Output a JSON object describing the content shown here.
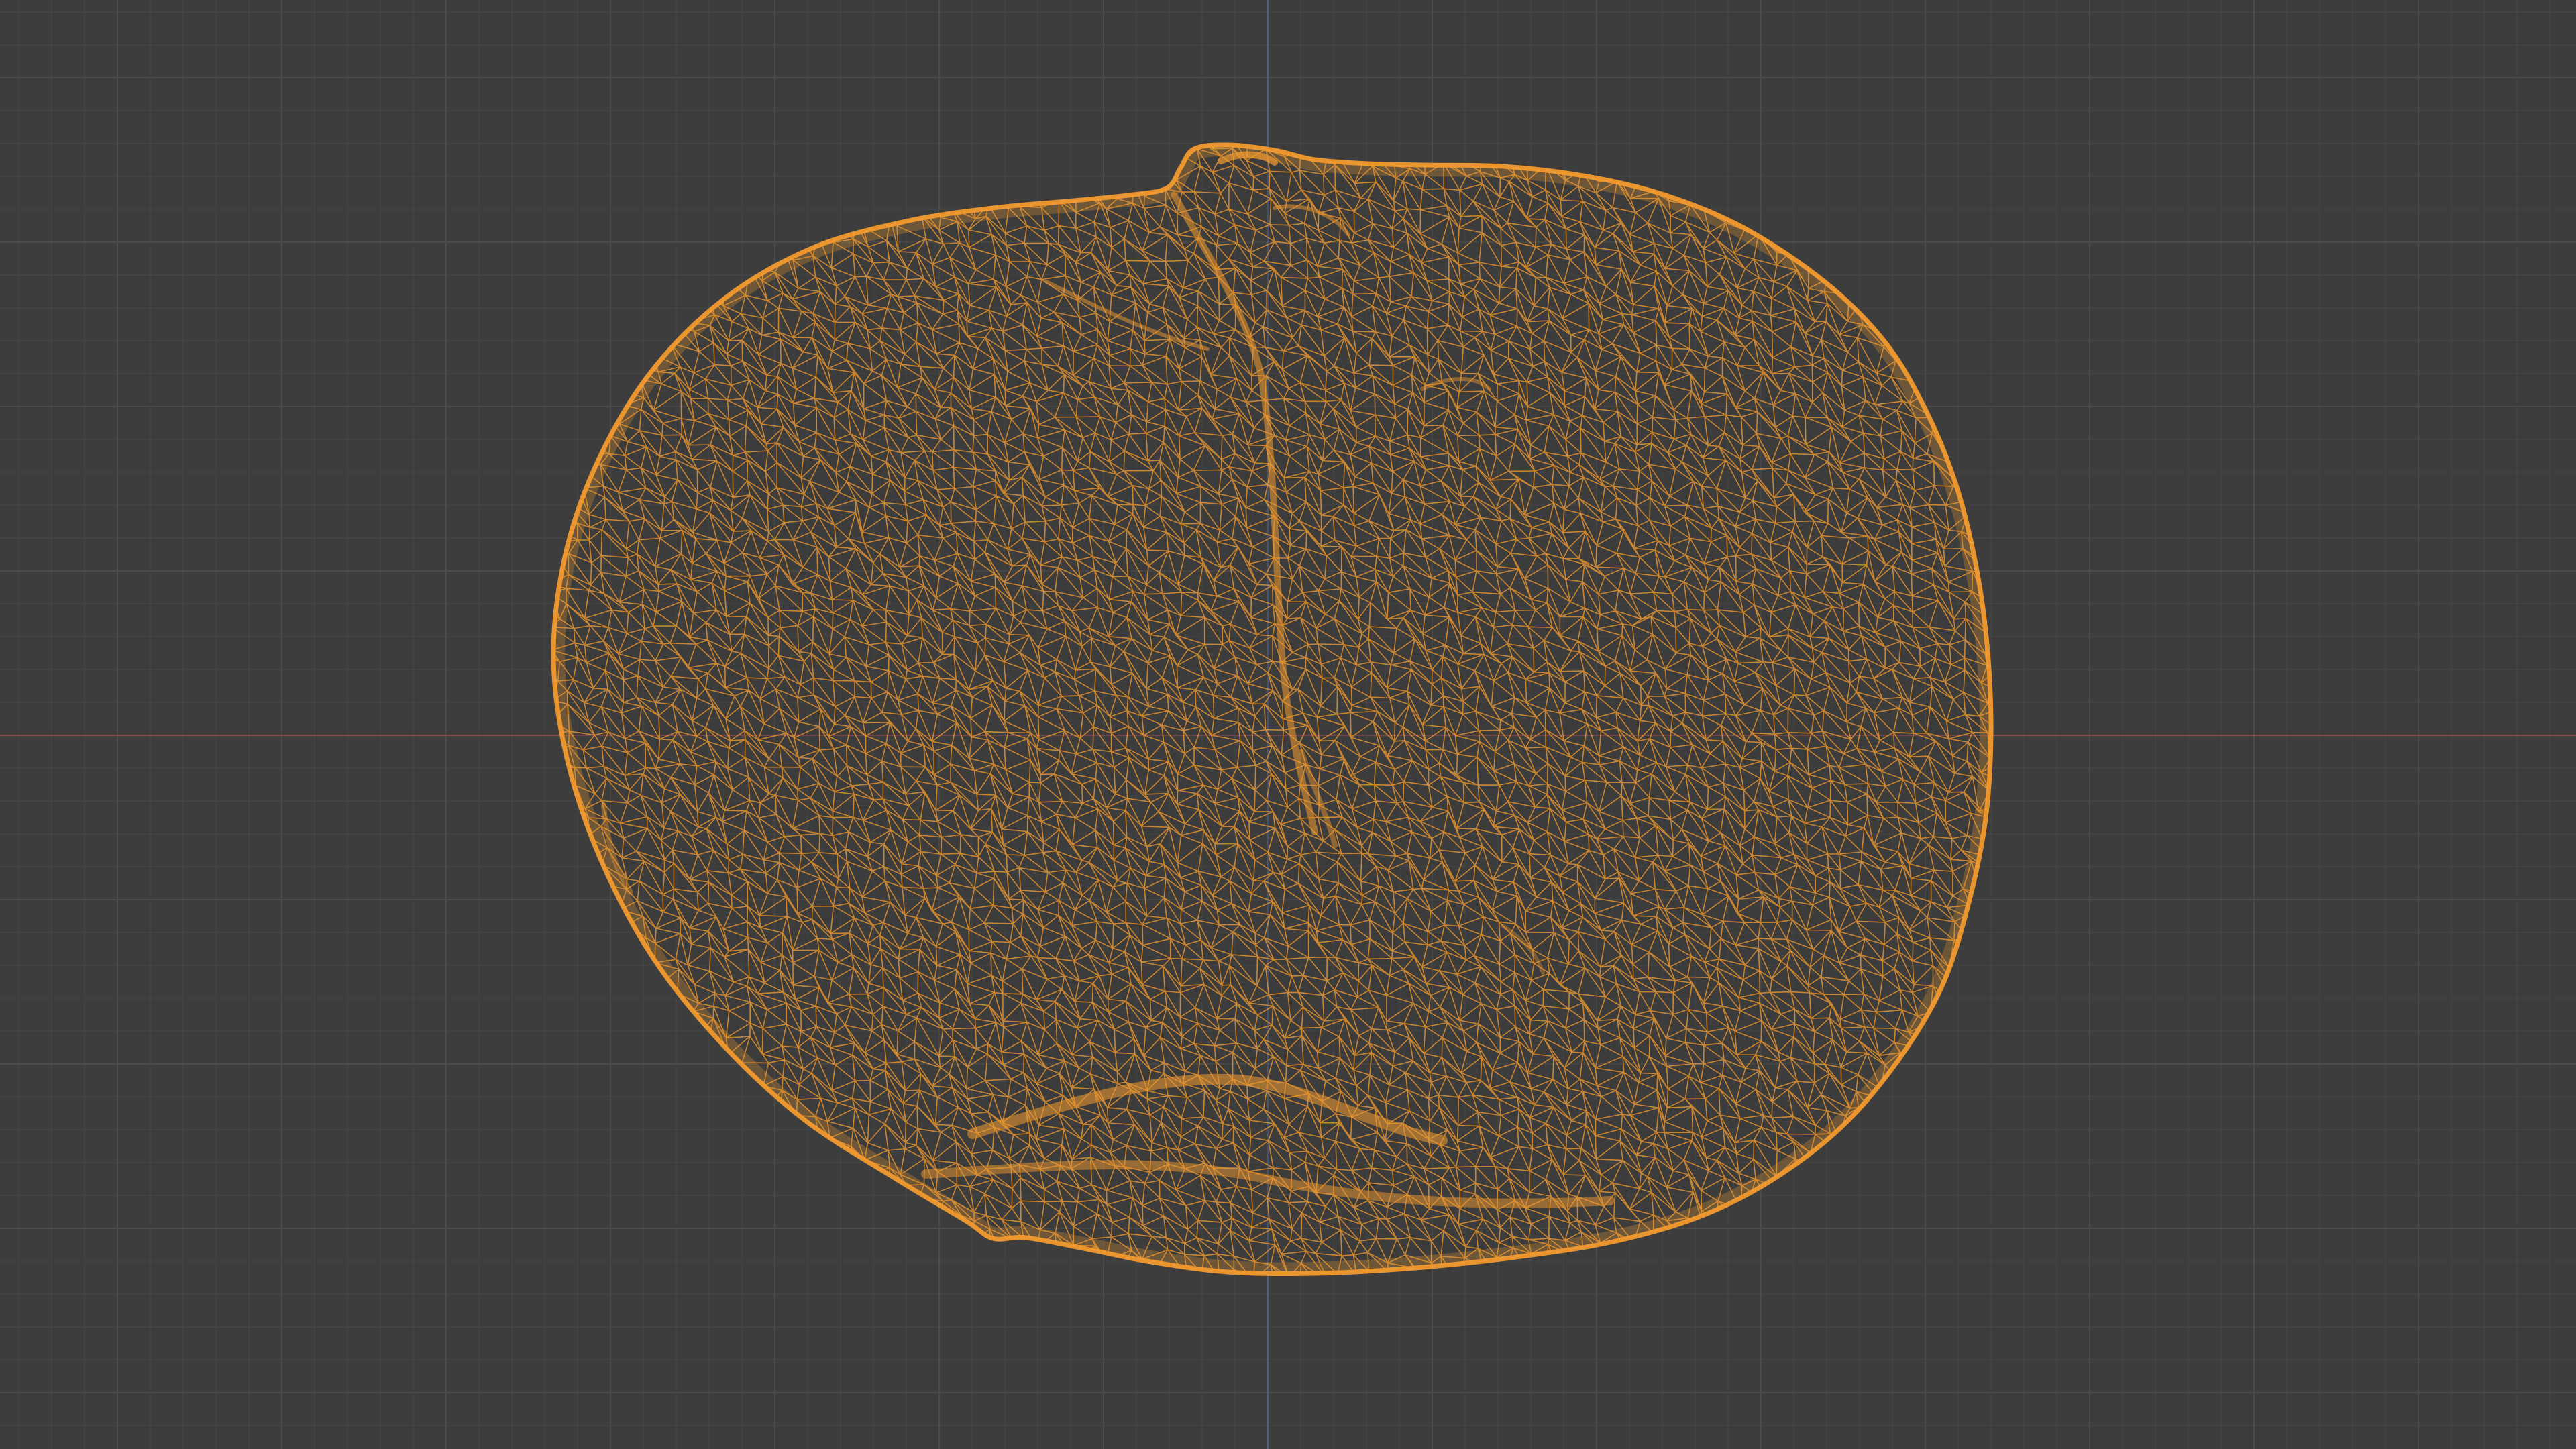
{
  "viewport": {
    "mode": "wireframe",
    "object": "scanned-mesh",
    "background_color": "#3d3d3d",
    "grid_minor_color": "#454545",
    "grid_major_color": "#4b4b4b",
    "x_axis_color": "#8a4b4f",
    "y_axis_color": "#4a5f8a",
    "wire_color": "#f29a2e",
    "grid_visible": true,
    "axes_visible": [
      "x",
      "z"
    ]
  }
}
